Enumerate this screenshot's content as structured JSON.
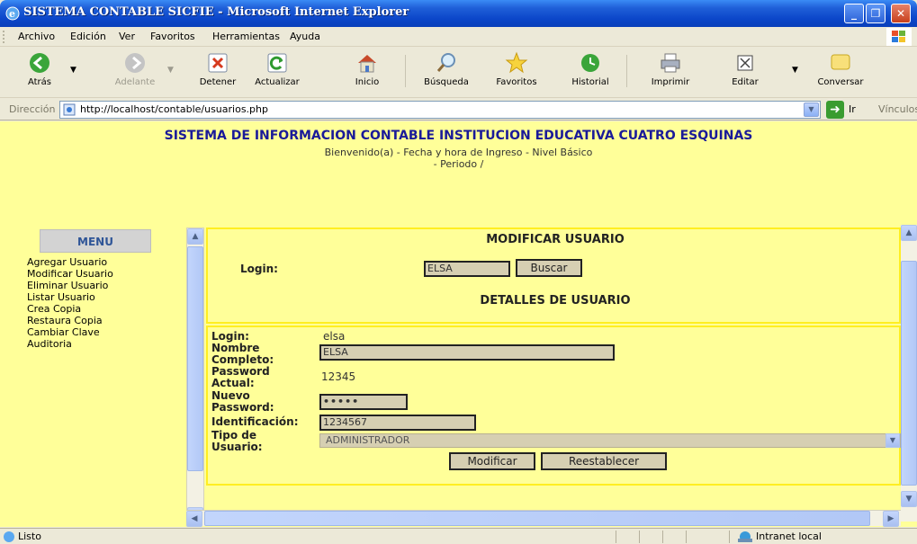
{
  "window": {
    "title": "SISTEMA CONTABLE SICFIE - Microsoft Internet Explorer",
    "minimize": "_",
    "maximize": "❐",
    "close": "✕"
  },
  "menubar": [
    "Archivo",
    "Edición",
    "Ver",
    "Favoritos",
    "Herramientas",
    "Ayuda"
  ],
  "toolbar": {
    "back": "Atrás",
    "forward": "Adelante",
    "stop": "Detener",
    "refresh": "Actualizar",
    "home": "Inicio",
    "search": "Búsqueda",
    "favorites": "Favoritos",
    "history": "Historial",
    "print": "Imprimir",
    "edit": "Editar",
    "messenger": "Conversar"
  },
  "address": {
    "label": "Dirección",
    "url": "http://localhost/contable/usuarios.php",
    "go": "Ir",
    "links": "Vínculos"
  },
  "header": {
    "title": "SISTEMA DE INFORMACION CONTABLE INSTITUCION EDUCATIVA CUATRO ESQUINAS",
    "line1": "Bienvenido(a) - Fecha y hora de Ingreso - Nivel Básico",
    "line2": "- Periodo /"
  },
  "menu": {
    "heading": "MENU",
    "items": [
      "Agregar Usuario",
      "Modificar Usuario",
      "Eliminar Usuario",
      "Listar Usuario",
      "Crea Copia",
      "Restaura Copia",
      "Cambiar Clave",
      "Auditoria"
    ]
  },
  "form": {
    "title": "MODIFICAR USUARIO",
    "login_label": "Login:",
    "login_value": "ELSA",
    "search_button": "Buscar",
    "details_title": "DETALLES DE USUARIO",
    "details": {
      "login_label": "Login:",
      "login_value": "elsa",
      "fullname_label_1": "Nombre",
      "fullname_label_2": "Completo:",
      "fullname_value": "ELSA",
      "curpass_label_1": "Password",
      "curpass_label_2": "Actual:",
      "curpass_value": "12345",
      "newpass_label_1": "Nuevo",
      "newpass_label_2": "Password:",
      "newpass_value": "•••••",
      "id_label": "Identificación:",
      "id_value": "1234567",
      "type_label_1": "Tipo de",
      "type_label_2": "Usuario:",
      "type_value": "ADMINISTRADOR"
    },
    "modify_button": "Modificar",
    "reset_button": "Reestablecer"
  },
  "status": {
    "text": "Listo",
    "zone": "Intranet local"
  }
}
